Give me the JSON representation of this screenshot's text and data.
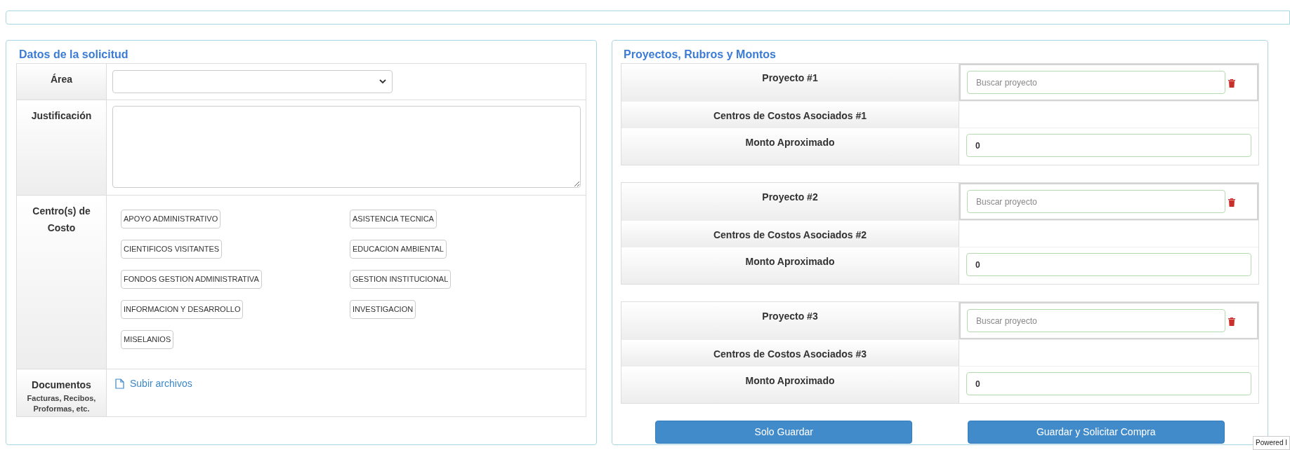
{
  "request": {
    "title": "Datos de la solicitud",
    "fields": [
      {
        "kind": "select",
        "label": "Área"
      },
      {
        "kind": "textarea",
        "label": "Justificación"
      },
      {
        "kind": "chips",
        "label": "Centro(s) de Costo",
        "chips": [
          "APOYO ADMINISTRATIVO",
          "ASISTENCIA TECNICA",
          "CIENTIFICOS VISITANTES",
          "EDUCACION AMBIENTAL",
          "FONDOS GESTION ADMINISTRATIVA",
          "GESTION INSTITUCIONAL",
          "INFORMACION Y DESARROLLO",
          "INVESTIGACION",
          "MISELANIOS"
        ]
      },
      {
        "kind": "upload",
        "label": "Documentos",
        "sublabel": "Facturas, Recibos, Proformas, etc.",
        "link": "Subir archivos"
      }
    ]
  },
  "projects": {
    "title": "Proyectos, Rubros y Montos",
    "items": [
      {
        "label": "Proyecto #1",
        "search_placeholder": "Buscar proyecto",
        "cost_centers_label": "Centros de Costos Asociados #1",
        "amount_label": "Monto Aproximado",
        "amount": "0"
      },
      {
        "label": "Proyecto #2",
        "search_placeholder": "Buscar proyecto",
        "cost_centers_label": "Centros de Costos Asociados #2",
        "amount_label": "Monto Aproximado",
        "amount": "0"
      },
      {
        "label": "Proyecto #3",
        "search_placeholder": "Buscar proyecto",
        "cost_centers_label": "Centros de Costos Asociados #3",
        "amount_label": "Monto Aproximado",
        "amount": "0"
      }
    ],
    "buttons": [
      "Solo Guardar",
      "Guardar y Solicitar Compra"
    ]
  },
  "badge": "Powered I"
}
